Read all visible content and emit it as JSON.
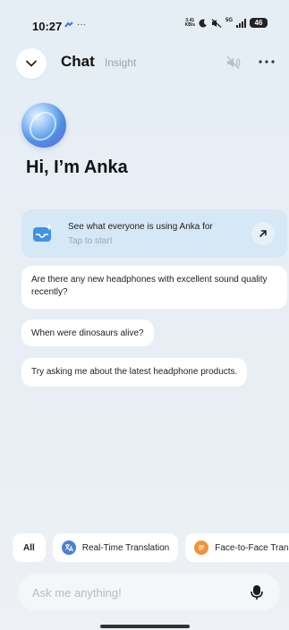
{
  "status_bar": {
    "time": "10:27",
    "extra": "···",
    "net_speed_value": "3.41",
    "net_speed_unit": "KB/s",
    "signal_label": "5G",
    "battery": "46"
  },
  "header": {
    "title": "Chat",
    "subtitle": "Insight"
  },
  "greeting": "Hi, I’m Anka",
  "feature_card": {
    "title": "See what everyone is using Anka for",
    "subtitle": "Tap to start"
  },
  "suggestions": [
    "Are there any new headphones with excellent sound quality recently?",
    "When were dinosaurs alive?",
    "Try asking me about the latest headphone products."
  ],
  "chips": {
    "all": "All",
    "translation": "Real-Time Translation",
    "face": "Face-to-Face Translat"
  },
  "input": {
    "placeholder": "Ask me anything!"
  },
  "colors": {
    "accent_blue": "#4a7fd8",
    "accent_orange": "#f0923a",
    "card_bg": "#d6e7f6"
  }
}
